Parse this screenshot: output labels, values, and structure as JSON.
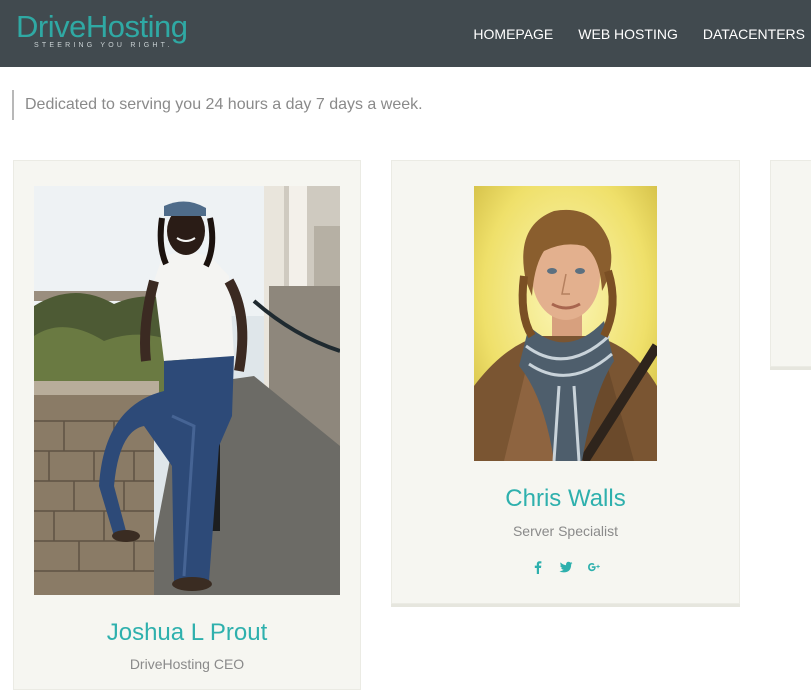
{
  "header": {
    "logo_text": "DriveHosting",
    "logo_tagline": "STEERING YOU RIGHT.",
    "nav": [
      {
        "label": "HOMEPAGE"
      },
      {
        "label": "WEB HOSTING"
      },
      {
        "label": "DATACENTERS"
      }
    ]
  },
  "tagline": "Dedicated to serving you 24 hours a day 7 days a week.",
  "team": [
    {
      "name": "Joshua L Prout",
      "role": "DriveHosting CEO",
      "photo_alt": "man-in-white-shirt-photo"
    },
    {
      "name": "Chris Walls",
      "role": "Server Specialist",
      "photo_alt": "man-with-scarf-photo",
      "social": [
        "facebook-icon",
        "twitter-icon",
        "google-plus-icon"
      ]
    }
  ],
  "colors": {
    "navbar": "#414a4f",
    "accent": "#2eb0ad",
    "card_bg": "#f6f6f1",
    "muted_text": "#8a8a8a"
  }
}
